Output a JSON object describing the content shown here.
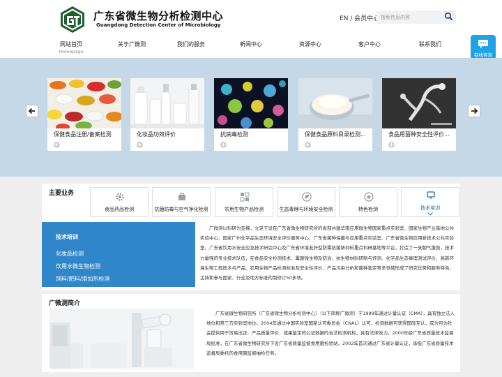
{
  "header": {
    "brand_cn": "广东省微生物分析检测中心",
    "brand_en": "Guangdong Detection Center of Microbiology",
    "top_links": "EN / 会员中心",
    "search_placeholder": "搜索信息内容",
    "online_label": "在线咨询"
  },
  "nav": [
    {
      "label": "网站首页",
      "sub": "Homepage"
    },
    {
      "label": "关于广微测"
    },
    {
      "label": "我们的服务"
    },
    {
      "label": "新闻中心"
    },
    {
      "label": "资源中心"
    },
    {
      "label": "客户中心"
    },
    {
      "label": "联系我们"
    }
  ],
  "banner": {
    "cards": [
      {
        "title": "保健食品注册/备案检测"
      },
      {
        "title": "化妆品功效评价"
      },
      {
        "title": "抗病毒检测"
      },
      {
        "title": "保健食品原料目录检测..."
      },
      {
        "title": "食品用菌种安全性评价..."
      }
    ]
  },
  "main_business": {
    "title": "主要业务",
    "services": [
      {
        "label": "食品药品检测",
        "icon": "gear-icon"
      },
      {
        "label": "抗菌防霉与空气净化检测",
        "icon": "box-icon"
      },
      {
        "label": "农用生物产品检测",
        "icon": "grid-icon"
      },
      {
        "label": "生态毒理与环境安全检测",
        "icon": "leaf-icon"
      },
      {
        "label": "特色检测",
        "icon": "star-icon"
      },
      {
        "label": "技术培训",
        "icon": "training-icon",
        "active": true
      }
    ],
    "side": {
      "heading": "技术培训",
      "items": [
        "化妆品检测",
        "饮用水微生物检测",
        "饲料/肥料/添加剂检测"
      ]
    },
    "text": "广微测以科研为支撑，立足于设在广东省微生物研究所的省部共建华南应用微生物国家重点实验室、国家生物产业基地公共实验中心、国家广州化学品生态环境安全评价服务中心、广东省菌种保藏与应用重点实验室、广东省微生物应用新技术公共实验室、广东省饮用水安全应急技术研究中心及广东省环境友好型防霉抗菌新材料重点科研基地等平台，打造了一支朝气蓬勃、技术力量强的专业技术队伍，在食品安全检测技术、霉腐微生物及防治、抗生物材料研制与评测、化学品生态毒理测试评价、高新环境生物工程技术与产品、农用生物产品检测标准及安全性评价、产品污染分析和菌种鉴定等多领域形成了研究优势和服务特色，主持和参与国家、行业及地方标准的制修订50多项。",
    "colors": {
      "accent": "#2f86c8",
      "active_text": "#1a6fb0"
    }
  },
  "intro": {
    "title": "广微测简介",
    "text": "广东省微生物研究所（广东省微生物分析检测中心）（以下简称广微测）于1999年通过计量认证（CMA），具有独立法人地位和第三方实验室地位。2004年通过中国实验室国家认可委员会（CNAL）认可，检测数据可获得国际互认，成为可为社会提供用于贸易出证、产品质量评价、成果鉴定的公证数据的合法检测机构，具有法律效力。2000年经广东省质量技术监督局批准，在广东省微生物研究所下设广东省质量监督食用菌检验站，2002年首次通过广东省计量认证，承担广东省质量技术监督局委托的食用菌监督抽检任务。"
  }
}
